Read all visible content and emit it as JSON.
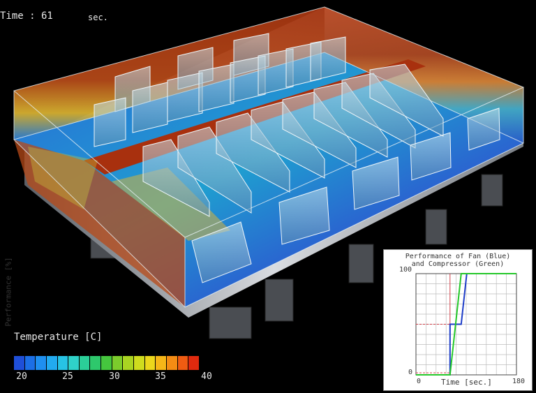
{
  "hud": {
    "time_label": "Time : 61",
    "time_unit": "sec."
  },
  "legend": {
    "title": "Temperature [C]",
    "ticks": [
      "20",
      "25",
      "30",
      "35",
      "40"
    ],
    "colors": [
      "#1f4fd8",
      "#1c6fe6",
      "#1f8ff0",
      "#22aaf0",
      "#27c3e4",
      "#2fd2c8",
      "#2bcf98",
      "#2ec86c",
      "#45c63e",
      "#7ccc2c",
      "#a9d422",
      "#cfdc1e",
      "#ecd71c",
      "#f6b618",
      "#f48c14",
      "#ef5c12",
      "#e02a0e"
    ]
  },
  "performance_chart": {
    "title_line1": "Performance of Fan (Blue)",
    "title_line2": "and Compressor (Green)",
    "ylabel": "Performance [%]",
    "xlabel": "Time [sec.]",
    "x_ticks": [
      "0",
      "180"
    ],
    "y_ticks": [
      "0",
      "100"
    ]
  },
  "chart_data": {
    "type": "line",
    "title": "Performance of Fan (Blue) and Compressor (Green)",
    "xlabel": "Time [sec.]",
    "ylabel": "Performance [%]",
    "xlim": [
      0,
      180
    ],
    "ylim": [
      0,
      100
    ],
    "grid": true,
    "series": [
      {
        "name": "Fan",
        "color": "#1d3cc8",
        "x": [
          0,
          61,
          61,
          81,
          91,
          180
        ],
        "y": [
          0,
          0,
          50,
          50,
          100,
          100
        ]
      },
      {
        "name": "Compressor",
        "color": "#24c82a",
        "x": [
          0,
          61,
          81,
          180
        ],
        "y": [
          0,
          0,
          100,
          100
        ]
      }
    ],
    "current_time": 61,
    "current_time_color": "#d0404a"
  },
  "colors": {
    "background": "#000000",
    "hot": "#b03010",
    "cold": "#1f4fd8"
  }
}
